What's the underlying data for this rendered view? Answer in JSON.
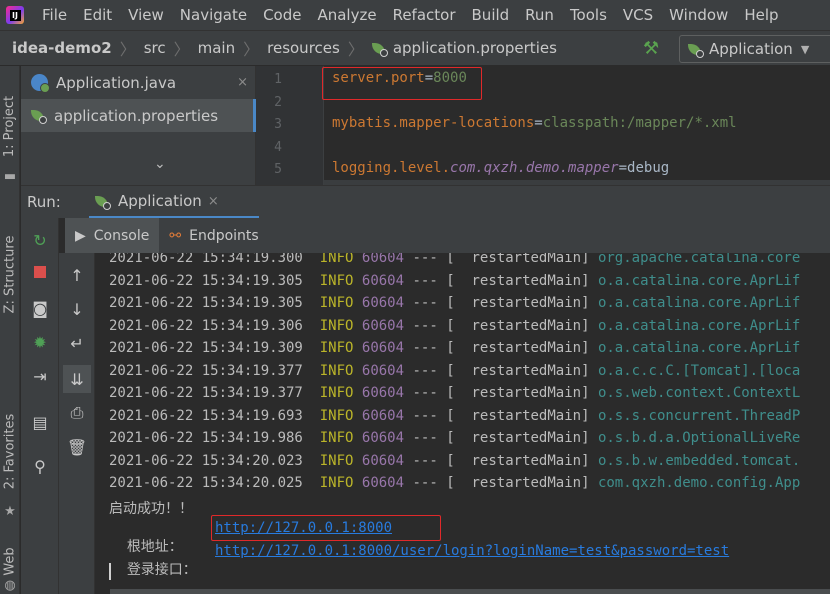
{
  "menu": [
    "File",
    "Edit",
    "View",
    "Navigate",
    "Code",
    "Analyze",
    "Refactor",
    "Build",
    "Run",
    "Tools",
    "VCS",
    "Window",
    "Help"
  ],
  "breadcrumbs": [
    "idea-demo2",
    "src",
    "main",
    "resources",
    "application.properties"
  ],
  "run_config": "Application",
  "left_stripe": {
    "project": "1: Project",
    "structure": "Z: Structure",
    "favorites": "2: Favorites",
    "web": "Web"
  },
  "editor_tabs": [
    {
      "name": "Application.java",
      "close": "×"
    },
    {
      "name": "application.properties"
    }
  ],
  "line_numbers": [
    "1",
    "2",
    "3",
    "4",
    "5"
  ],
  "code": {
    "line1_key": "server.port",
    "line1_eq": "=",
    "line1_val": "8000",
    "line3_key": "mybatis.mapper-locations",
    "line3_eq": "=",
    "line3_val": "classpath:/mapper/*.xml",
    "line5_key_a": "logging.level.",
    "line5_key_b": "com.qxzh.demo.mapper",
    "line5_eq": "=",
    "line5_val": "debug"
  },
  "run_window": {
    "label": "Run:",
    "tab": "Application",
    "close": "×"
  },
  "console_tabs": [
    "Console",
    "Endpoints"
  ],
  "log_lines": [
    {
      "ts": "2021-06-22 15:34:19.300",
      "level": "INFO",
      "pid": "60604",
      "sep": "---",
      "thread": "[  restartedMain]",
      "logger": "org.apache.catalina.core"
    },
    {
      "ts": "2021-06-22 15:34:19.305",
      "level": "INFO",
      "pid": "60604",
      "sep": "---",
      "thread": "[  restartedMain]",
      "logger": "o.a.catalina.core.AprLif"
    },
    {
      "ts": "2021-06-22 15:34:19.305",
      "level": "INFO",
      "pid": "60604",
      "sep": "---",
      "thread": "[  restartedMain]",
      "logger": "o.a.catalina.core.AprLif"
    },
    {
      "ts": "2021-06-22 15:34:19.306",
      "level": "INFO",
      "pid": "60604",
      "sep": "---",
      "thread": "[  restartedMain]",
      "logger": "o.a.catalina.core.AprLif"
    },
    {
      "ts": "2021-06-22 15:34:19.309",
      "level": "INFO",
      "pid": "60604",
      "sep": "---",
      "thread": "[  restartedMain]",
      "logger": "o.a.catalina.core.AprLif"
    },
    {
      "ts": "2021-06-22 15:34:19.377",
      "level": "INFO",
      "pid": "60604",
      "sep": "---",
      "thread": "[  restartedMain]",
      "logger": "o.a.c.c.C.[Tomcat].[loca"
    },
    {
      "ts": "2021-06-22 15:34:19.377",
      "level": "INFO",
      "pid": "60604",
      "sep": "---",
      "thread": "[  restartedMain]",
      "logger": "o.s.web.context.ContextL"
    },
    {
      "ts": "2021-06-22 15:34:19.693",
      "level": "INFO",
      "pid": "60604",
      "sep": "---",
      "thread": "[  restartedMain]",
      "logger": "o.s.s.concurrent.ThreadP"
    },
    {
      "ts": "2021-06-22 15:34:19.986",
      "level": "INFO",
      "pid": "60604",
      "sep": "---",
      "thread": "[  restartedMain]",
      "logger": "o.s.b.d.a.OptionalLiveRe"
    },
    {
      "ts": "2021-06-22 15:34:20.023",
      "level": "INFO",
      "pid": "60604",
      "sep": "---",
      "thread": "[  restartedMain]",
      "logger": "o.s.b.w.embedded.tomcat."
    },
    {
      "ts": "2021-06-22 15:34:20.025",
      "level": "INFO",
      "pid": "60604",
      "sep": "---",
      "thread": "[  restartedMain]",
      "logger": "com.qxzh.demo.config.App"
    }
  ],
  "startup": {
    "success": "启动成功！！",
    "root_label": "根地址：",
    "root_url": "http://127.0.0.1:8000",
    "login_label": "登录接口：",
    "login_url": "http://127.0.0.1:8000/user/login?loginName=test&password=test"
  },
  "colors": {
    "highlight_box": "#e0292a",
    "link": "#287bde",
    "info": "#bbb529",
    "accent": "#4a88c7"
  }
}
